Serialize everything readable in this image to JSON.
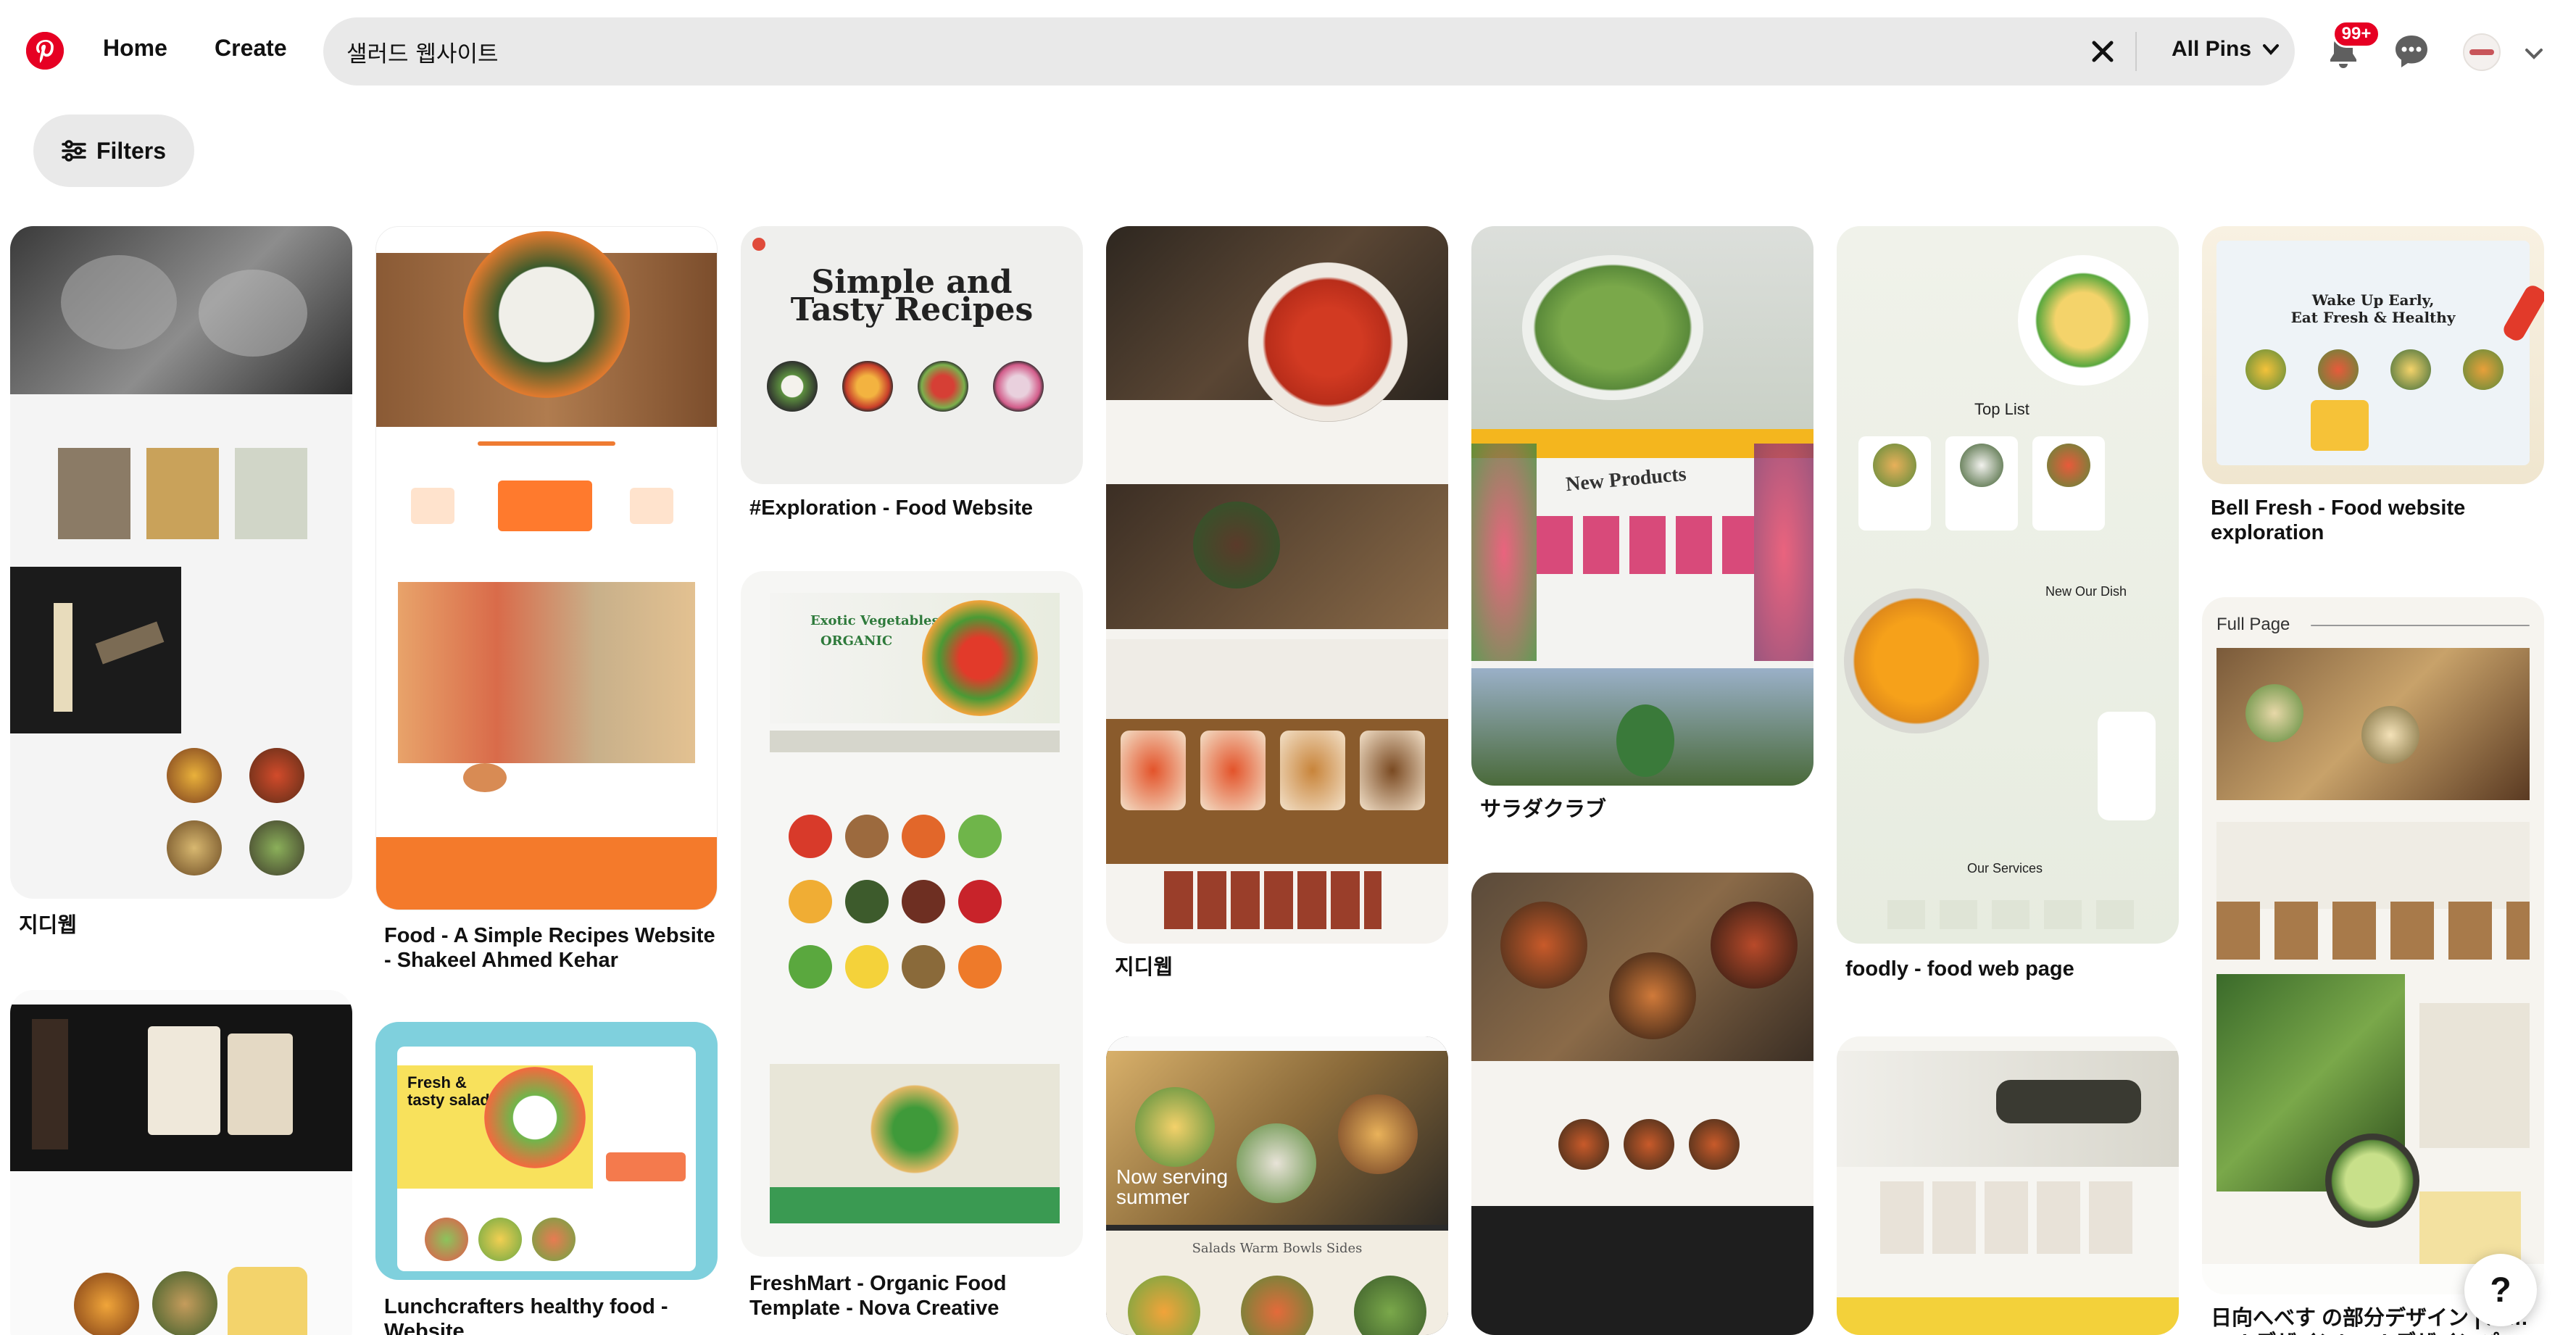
{
  "header": {
    "logo": "pinterest-logo",
    "nav": {
      "home": "Home",
      "create": "Create"
    },
    "search": {
      "value": "샐러드 웹사이트",
      "scope": "All Pins"
    },
    "notifications_badge": "99+"
  },
  "filters": {
    "label": "Filters"
  },
  "pins": [
    {
      "title": "지디웹"
    },
    {
      "title": "Food - A Simple Recipes Website - Shakeel Ahmed Kehar"
    },
    {
      "title": "#Exploration - Food Website",
      "hero_title_1": "Simple and",
      "hero_title_2": "Tasty Recipes"
    },
    {
      "title": "FreshMart - Organic Food Template - Nova Creative",
      "hero_text_1": "Exotic Vegetables",
      "hero_text_2": "ORGANIC"
    },
    {
      "title": "지디웹"
    },
    {
      "title": "サラダクラブ",
      "banner": "New Products"
    },
    {
      "title": "foodly - food web page",
      "text_1": "Top  List",
      "text_2": "New Our Dish",
      "text_3": "Our Services"
    },
    {
      "title": "Bell Fresh - Food website exploration",
      "hero_1": "Wake Up Early,",
      "hero_2": "Eat Fresh & Healthy"
    },
    {
      "title": "日向へべす の部分デザイン | パ… Webデザイン| Webデザインパー…",
      "label": "Full Page"
    },
    {
      "title": "Lunchcrafters healthy food - Website",
      "hero": "Fresh & tasty salads"
    },
    {
      "title": "",
      "hero": "Now serving summer",
      "tabs": "Salads   Warm Bowls   Sides"
    }
  ],
  "help": "?"
}
